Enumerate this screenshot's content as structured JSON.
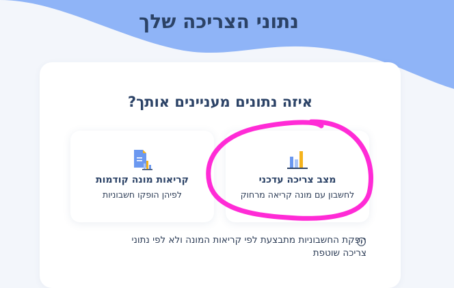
{
  "page": {
    "title": "נתוני הצריכה שלך",
    "question": "איזה נתונים מעניינים אותך?"
  },
  "options": [
    {
      "title": "מצב צריכה עדכני",
      "subtitle": "לחשבון עם מונה קריאה מרחוק",
      "icon": "bar-chart-icon"
    },
    {
      "title": "קריאות מונה קודמות",
      "subtitle": "לפיהן הופקו חשבוניות",
      "icon": "document-chart-icon"
    }
  ],
  "footnote": {
    "icon": "info-icon",
    "text": "הפקת החשבוניות מתבצעת לפי קריאות המונה ולא לפי נתוני צריכה שוטפת"
  },
  "colors": {
    "header_blue": "#8fb4f7",
    "title_navy": "#2b4266",
    "annotation_magenta": "#ff2bd6",
    "chart_orange": "#f5b31c",
    "chart_blue": "#6b98f0"
  }
}
